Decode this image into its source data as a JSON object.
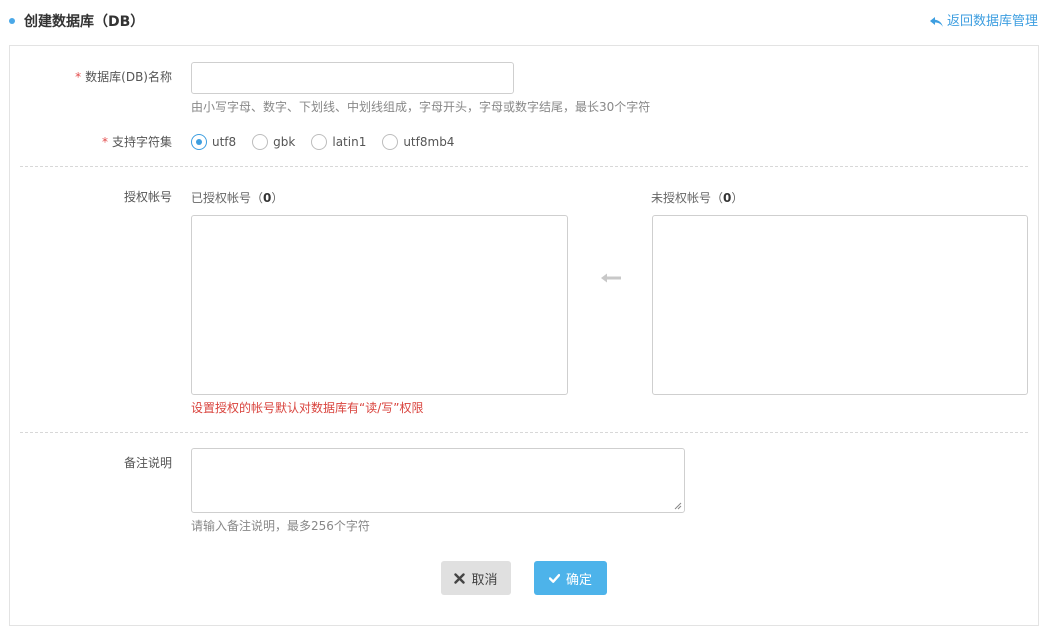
{
  "header": {
    "title": "创建数据库（DB）",
    "back_link": "返回数据库管理"
  },
  "form": {
    "db_name": {
      "required_mark": "*",
      "label": "数据库(DB)名称",
      "value": "",
      "hint": "由小写字母、数字、下划线、中划线组成，字母开头，字母或数字结尾，最长30个字符"
    },
    "charset": {
      "required_mark": "*",
      "label": "支持字符集",
      "selected": "utf8",
      "options": [
        "utf8",
        "gbk",
        "latin1",
        "utf8mb4"
      ]
    },
    "accounts": {
      "label": "授权帐号",
      "authorized": {
        "prefix": "已授权帐号（",
        "count": "0",
        "suffix": "）"
      },
      "unauthorized": {
        "prefix": "未授权帐号（",
        "count": "0",
        "suffix": "）"
      },
      "note": "设置授权的帐号默认对数据库有“读/写”权限"
    },
    "remark": {
      "label": "备注说明",
      "value": "",
      "hint": "请输入备注说明，最多256个字符"
    }
  },
  "actions": {
    "cancel": "取消",
    "confirm": "确定"
  },
  "colors": {
    "accent": "#3d9ee0",
    "required": "#e34b4b",
    "warning_text": "#d9433d",
    "confirm_button": "#4db3ea",
    "cancel_button": "#e0e0e0"
  }
}
